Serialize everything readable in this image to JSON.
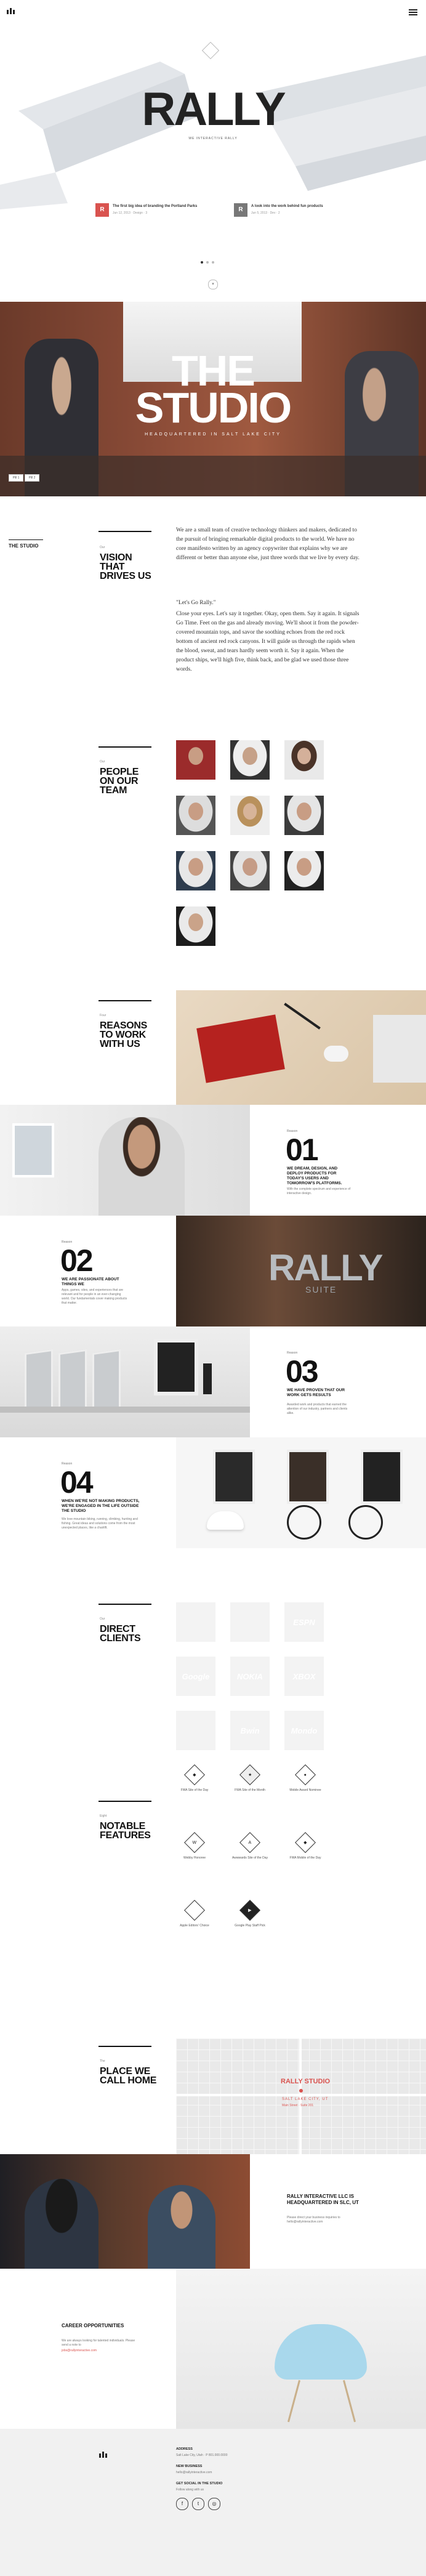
{
  "colors": {
    "accent": "#d9534f",
    "dark": "#111111",
    "gray": "#f1f1f1"
  },
  "hero": {
    "title": "RALLY",
    "subtitle": "WE INTERACTIVE RALLY",
    "news": [
      {
        "title": "The first big idea of branding the Portland Parks",
        "meta": "Jun 12, 2013 · Design · 3"
      },
      {
        "title": "A look into the work behind fun products",
        "meta": "Jun 5, 2013 · Dev · 2"
      }
    ]
  },
  "studio": {
    "title_line1": "THE",
    "title_line2": "STUDIO",
    "tagline": "HEADQUARTERED IN SALT LAKE CITY"
  },
  "subnav": {
    "item1": "Pill 1",
    "item2": "Pill 2",
    "heading": "THE STUDIO"
  },
  "vision": {
    "kicker": "Our",
    "title": "VISION THAT DRIVES US",
    "p1": "We are a small team of creative technology thinkers and makers, dedicated to the pursuit of bringing remarkable digital products to the world. We have no core manifesto written by an agency copywriter that explains why we are different or better than anyone else, just three words that we live by every day.",
    "p2": "\"Let's Go Rally.\"",
    "p3": "Close your eyes. Let's say it together. Okay, open them. Say it again. It signals Go Time. Feet on the gas and already moving. We'll shoot it from the powder-covered mountain tops, and savor the soothing echoes from the red rock bottom of ancient red rock canyons. It will guide us through the rapids when the blood, sweat, and tears hardly seem worth it. Say it again. When the product ships, we'll high five, think back, and be glad we used those three words."
  },
  "team": {
    "kicker": "Our",
    "title": "PEOPLE ON OUR TEAM"
  },
  "reasons": {
    "kicker": "Four",
    "title": "REASONS TO WORK WITH US",
    "items": [
      {
        "num": "01",
        "label": "Reason",
        "title": "WE DREAM, DESIGN, AND DEPLOY PRODUCTS FOR TODAY'S USERS AND TOMORROW'S PLATFORMS.",
        "text": "With the complete spectrum and experience of interactive design."
      },
      {
        "num": "02",
        "label": "Reason",
        "title": "WE ARE PASSIONATE ABOUT THINGS WE",
        "text": "Apps, games, sites, and experiences that are relevant and for people in an ever-changing world. Our fundamentals cover making products that matter."
      },
      {
        "num": "03",
        "label": "Reason",
        "title": "WE HAVE PROVEN THAT OUR WORK GETS RESULTS",
        "text": "Awarded work and products that earned the attention of our industry, partners and clients alike."
      },
      {
        "num": "04",
        "label": "Reason",
        "title": "WHEN WE'RE NOT MAKING PRODUCTS, WE'RE ENGAGED IN THE LIFE OUTSIDE THE STUDIO",
        "text": "We love mountain biking, running, climbing, hunting and fishing. Great ideas and solutions come from the most unexpected places, like a chairlift."
      }
    ]
  },
  "clients": {
    "kicker": "Our",
    "title": "DIRECT CLIENTS",
    "logos": [
      "",
      "",
      "ESPN",
      "Google",
      "NOKIA",
      "XBOX",
      "",
      "Bwin",
      "Mondo"
    ]
  },
  "features": {
    "kicker": "Eight",
    "title": "NOTABLE FEATURES",
    "items": [
      "FWA Site of the Day",
      "FWA Site of the Month",
      "Mobile Award Nominee",
      "Webby Honoree",
      "Awwwards Site of the Day",
      "FWA Mobile of the Day",
      "Apple Editors' Choice",
      "Google Play Staff Pick"
    ]
  },
  "home": {
    "kicker": "The",
    "title": "PLACE WE CALL HOME",
    "map_title": "RALLY STUDIO",
    "map_address": "SALT LAKE CITY, UT",
    "map_detail": "Main Street · Suite 201",
    "hq_title": "RALLY INTERACTIVE LLC IS HEADQUARTERED IN SLC, UT",
    "hq_text": "Please direct your business inquiries to hello@rallyinteractive.com"
  },
  "careers": {
    "title": "CAREER OPPORTUNITIES",
    "text": "We are always looking for talented individuals. Please send a note to",
    "email": "jobs@rallyinteractive.com"
  },
  "footer": {
    "address_label": "ADDRESS",
    "address": "Salt Lake City, Utah · P 801.000.0000",
    "biz_label": "NEW BUSINESS",
    "biz": "hello@rallyinteractive.com",
    "follow_label": "GET SOCIAL IN THE STUDIO",
    "follow": "Follow along with us"
  }
}
